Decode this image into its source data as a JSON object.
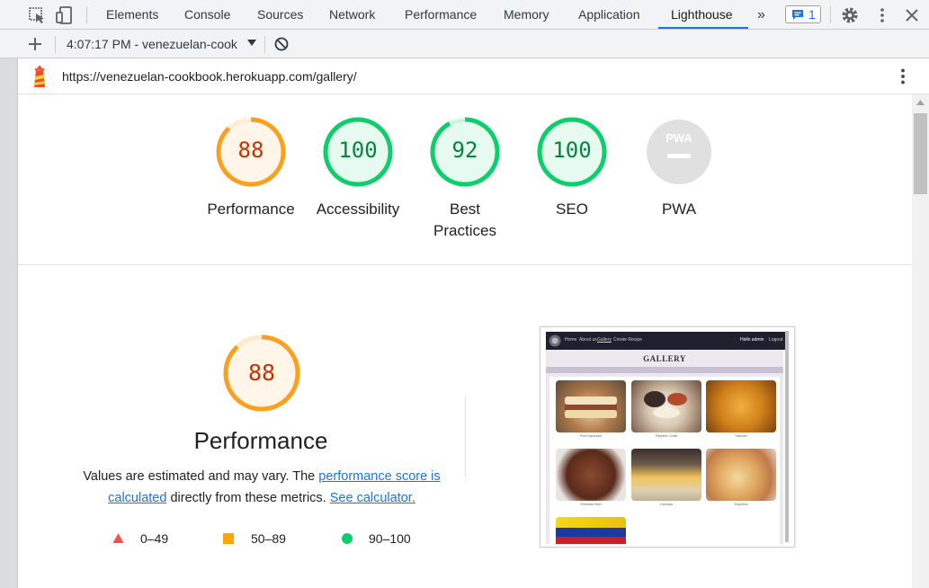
{
  "devtools": {
    "tabs": [
      "Elements",
      "Console",
      "Sources",
      "Network",
      "Performance",
      "Memory",
      "Application",
      "Lighthouse"
    ],
    "active_tab": "Lighthouse",
    "more_tabs": "»",
    "issues_count": "1",
    "icons": [
      "inspect-element-icon",
      "device-toolbar-icon",
      "issues-icon",
      "settings-gear-icon",
      "kebab-menu-icon",
      "close-icon"
    ]
  },
  "lighthouse_toolbar": {
    "add_label": "+",
    "report_selector": "4:07:17 PM - venezuelan-cook",
    "icons": [
      "plus-icon",
      "dropdown-caret-icon",
      "clear-block-icon"
    ]
  },
  "urlbar": {
    "url": "https://venezuelan-cookbook.herokuapp.com/gallery/",
    "icons": [
      "lighthouse-logo-icon",
      "kebab-menu-icon"
    ]
  },
  "gauges": [
    {
      "score": "88",
      "label": "Performance",
      "value": 0.88,
      "color": "#fa9f1e",
      "bg": "#fff6e9",
      "text": "#c33300"
    },
    {
      "score": "100",
      "label": "Accessibility",
      "value": 1.0,
      "color": "#0cce6b",
      "bg": "#e6faf0",
      "text": "#018642"
    },
    {
      "score": "92",
      "label": "Best Practices",
      "label_lines": [
        "Best",
        "Practices"
      ],
      "value": 0.92,
      "color": "#0cce6b",
      "bg": "#e6faf0",
      "text": "#018642"
    },
    {
      "score": "100",
      "label": "SEO",
      "value": 1.0,
      "color": "#0cce6b",
      "bg": "#e6faf0",
      "text": "#018642"
    },
    {
      "score": "PWA",
      "label": "PWA",
      "value": 0,
      "color": "#e0e0e0",
      "bg": "#e0e0e0",
      "text": "#ffffff"
    }
  ],
  "performance": {
    "score": "88",
    "value": 0.88,
    "title": "Performance",
    "desc_1": "Values are estimated and may vary. The ",
    "link_1": "performance score is calculated",
    "desc_2": " directly from these metrics. ",
    "link_2": "See calculator.",
    "legend": [
      {
        "range": "0–49",
        "shape": "triangle",
        "color": "#ff4e42"
      },
      {
        "range": "50–89",
        "shape": "square",
        "color": "#ffa400"
      },
      {
        "range": "90–100",
        "shape": "circle",
        "color": "#0cce6b"
      }
    ]
  },
  "screenshot": {
    "nav_items": [
      "Home",
      "About us",
      "Gallery",
      "Create Recipe"
    ],
    "nav_user": "Hello admin",
    "nav_logout": "Logout",
    "heading": "GALLERY",
    "captions": [
      "Pernil sandwich",
      "Pabellón Criollo",
      "Tostones",
      "Shredded Beef",
      "Cachapa",
      "Tequeños",
      ""
    ]
  }
}
